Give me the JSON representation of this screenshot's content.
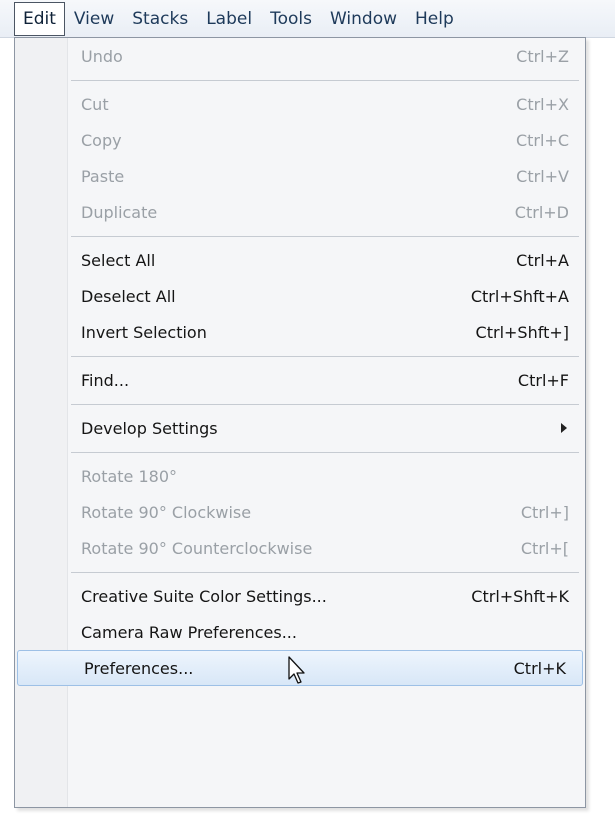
{
  "menubar": {
    "items": [
      {
        "label": "Edit",
        "active": true
      },
      {
        "label": "View"
      },
      {
        "label": "Stacks"
      },
      {
        "label": "Label"
      },
      {
        "label": "Tools"
      },
      {
        "label": "Window"
      },
      {
        "label": "Help"
      }
    ]
  },
  "edit_menu": {
    "items": [
      {
        "label": "Undo",
        "shortcut": "Ctrl+Z",
        "enabled": false
      },
      {
        "separator": true
      },
      {
        "label": "Cut",
        "shortcut": "Ctrl+X",
        "enabled": false
      },
      {
        "label": "Copy",
        "shortcut": "Ctrl+C",
        "enabled": false
      },
      {
        "label": "Paste",
        "shortcut": "Ctrl+V",
        "enabled": false
      },
      {
        "label": "Duplicate",
        "shortcut": "Ctrl+D",
        "enabled": false
      },
      {
        "separator": true
      },
      {
        "label": "Select All",
        "shortcut": "Ctrl+A",
        "enabled": true
      },
      {
        "label": "Deselect All",
        "shortcut": "Ctrl+Shft+A",
        "enabled": true
      },
      {
        "label": "Invert Selection",
        "shortcut": "Ctrl+Shft+]",
        "enabled": true
      },
      {
        "separator": true
      },
      {
        "label": "Find...",
        "shortcut": "Ctrl+F",
        "enabled": true
      },
      {
        "separator": true
      },
      {
        "label": "Develop Settings",
        "shortcut": "",
        "enabled": true,
        "submenu": true
      },
      {
        "separator": true
      },
      {
        "label": "Rotate 180°",
        "shortcut": "",
        "enabled": false
      },
      {
        "label": "Rotate 90° Clockwise",
        "shortcut": "Ctrl+]",
        "enabled": false
      },
      {
        "label": "Rotate 90° Counterclockwise",
        "shortcut": "Ctrl+[",
        "enabled": false
      },
      {
        "separator": true
      },
      {
        "label": "Creative Suite Color Settings...",
        "shortcut": "Ctrl+Shft+K",
        "enabled": true
      },
      {
        "label": "Camera Raw Preferences...",
        "shortcut": "",
        "enabled": true
      },
      {
        "label": "Preferences...",
        "shortcut": "Ctrl+K",
        "enabled": true,
        "highlighted": true
      }
    ]
  },
  "icons": {
    "submenu": "chevron-right-icon",
    "cursor": "mouse-pointer-icon"
  },
  "colors": {
    "menubar_text": "#1e3a5a",
    "enabled_text": "#151515",
    "disabled_text": "#9aa0a6",
    "highlight_border": "#9dc0e6",
    "highlight_fill": "#d8e7f7"
  }
}
